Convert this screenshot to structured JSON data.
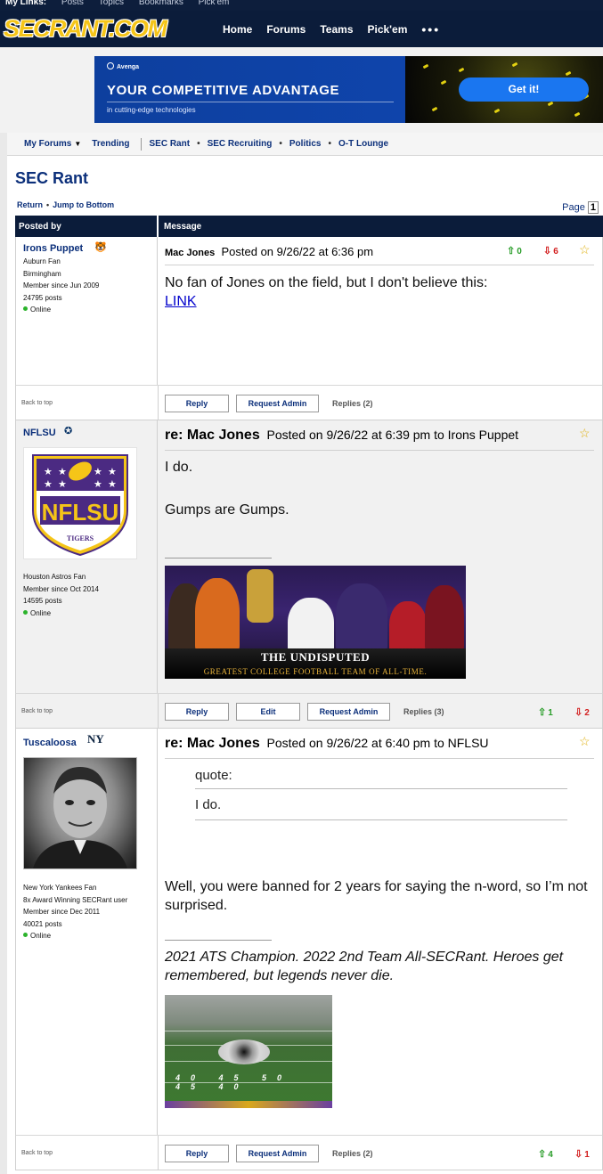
{
  "mylinks": {
    "label": "My Links:",
    "items": [
      "Posts",
      "Topics",
      "Bookmarks",
      "Pick'em"
    ]
  },
  "header": {
    "logo": "SECRANT.COM",
    "nav": [
      "Home",
      "Forums",
      "Teams",
      "Pick'em"
    ],
    "more": "•••"
  },
  "ad": {
    "brand": "Avenga",
    "headline": "YOUR COMPETITIVE ADVANTAGE",
    "sub": "in cutting-edge technologies",
    "cta": "Get it!"
  },
  "subnav": {
    "my_forums": "My Forums",
    "trending": "Trending",
    "items": [
      "SEC Rant",
      "SEC Recruiting",
      "Politics",
      "O-T Lounge"
    ],
    "sep": "•"
  },
  "forum": {
    "title": "SEC Rant",
    "return": "Return",
    "jump": "Jump to Bottom",
    "page_label": "Page",
    "page_num": "1"
  },
  "table": {
    "col_posted_by": "Posted by",
    "col_message": "Message"
  },
  "common": {
    "back_to_top": "Back to top",
    "reply": "Reply",
    "edit": "Edit",
    "request_admin": "Request Admin"
  },
  "posts": [
    {
      "user": "Irons Puppet",
      "info": [
        "Auburn Fan",
        "Birmingham",
        "Member since Jun 2009",
        "24795 posts",
        "Online"
      ],
      "title": "Mac Jones",
      "meta": "Posted on 9/26/22 at 6:36 pm",
      "up": "0",
      "down": "6",
      "body_1": "No fan of Jones on the field, but I don't believe this:",
      "link": "LINK",
      "replies": "Replies (2)"
    },
    {
      "user": "NFLSU",
      "logo_text": "NFLSU",
      "logo_sub": "TIGERS",
      "info": [
        "Houston Astros Fan",
        "Member since Oct 2014",
        "14595 posts",
        "Online"
      ],
      "title": "re: Mac Jones",
      "meta": "Posted on 9/26/22 at 6:39 pm to Irons Puppet",
      "body_1": "I do.",
      "body_2": "Gumps are Gumps.",
      "sig_img_line1": "THE UNDISPUTED",
      "sig_img_line2": "GREATEST COLLEGE FOOTBALL TEAM OF ALL-TIME.",
      "replies": "Replies (3)",
      "up": "1",
      "down": "2"
    },
    {
      "user": "Tuscaloosa",
      "info": [
        "New York Yankees Fan",
        "8x Award Winning SECRant user",
        "Member since Dec 2011",
        "40021 posts",
        "Online"
      ],
      "title": "re: Mac Jones",
      "meta": "Posted on 9/26/22 at 6:40 pm to NFLSU",
      "quote_label": "quote:",
      "quote_text": "I do.",
      "body_1": "Well, you were banned for 2 years for saying the n-word, so I’m not surprised.",
      "sig": "2021 ATS Champion. 2022 2nd Team All-SECRant. Heroes get remembered, but legends never die.",
      "field_nums": "40 45 50 45 40",
      "replies": "Replies (2)",
      "up": "4",
      "down": "1"
    }
  ],
  "colors": {
    "navy": "#0b1c3a",
    "link_blue": "#0b2f7a",
    "up_green": "#2a9d2a",
    "down_red": "#d32020",
    "logo_gold": "#f5c518"
  },
  "icons": [
    "auburn-icon",
    "astros-icon",
    "yankees-icon",
    "star-icon",
    "thumb-up-arrow-icon",
    "thumb-down-arrow-icon",
    "online-dot-icon"
  ]
}
